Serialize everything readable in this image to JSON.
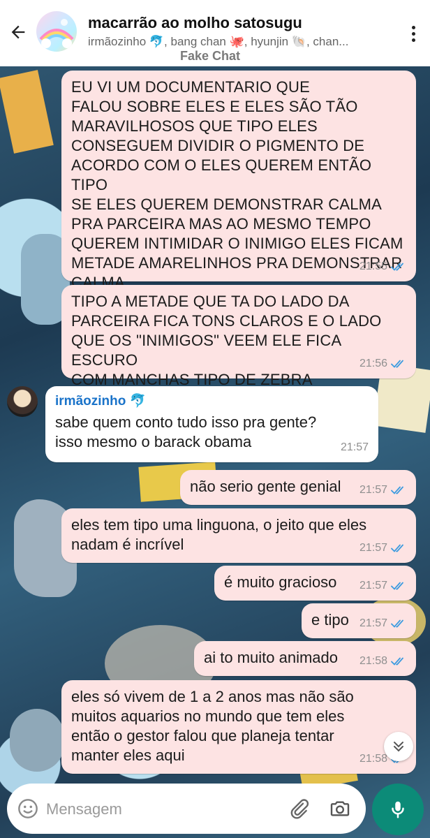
{
  "header": {
    "title": "macarrão ao molho satosugu",
    "subtitle": "irmãozinho 🐬, bang chan 🐙, hyunjin 🐚, chan...",
    "watermark": "Fake Chat"
  },
  "messages": [
    {
      "direction": "out",
      "text": "EU VI UM DOCUMENTARIO QUE\nFALOU SOBRE ELES E ELES SÃO TÃO\nMARAVILHOSOS QUE TIPO ELES\nCONSEGUEM DIVIDIR O PIGMENTO DE\nACORDO COM O ELES QUEREM ENTÃO TIPO\nSE ELES QUEREM DEMONSTRAR CALMA\nPRA PARCEIRA MAS AO MESMO TEMPO\nQUEREM INTIMIDAR O INIMIGO ELES FICAM\nMETADE AMARELINHOS PRA DEMONSTRAR\nCALMA",
      "time": "21:55"
    },
    {
      "direction": "out",
      "text": "TIPO A METADE QUE TA DO LADO DA\nPARCEIRA FICA TONS CLAROS E O LADO\nQUE OS \"INIMIGOS\" VEEM ELE FICA ESCURO\nCOM MANCHAS TIPO DE ZEBRA",
      "time": "21:56"
    },
    {
      "direction": "in",
      "sender": "irmãozinho 🐬",
      "text": "sabe quem conto tudo isso pra gente?\nisso mesmo o barack obama",
      "time": "21:57"
    },
    {
      "direction": "out",
      "text": "não serio gente genial",
      "time": "21:57"
    },
    {
      "direction": "out",
      "text": "eles tem tipo uma linguona, o jeito que eles\nnadam é incrível",
      "time": "21:57"
    },
    {
      "direction": "out",
      "text": "é muito gracioso",
      "time": "21:57"
    },
    {
      "direction": "out",
      "text": "e tipo",
      "time": "21:57"
    },
    {
      "direction": "out",
      "text": "ai to muito animado",
      "time": "21:58"
    },
    {
      "direction": "out",
      "text": "eles só vivem de 1 a 2 anos mas não são\nmuitos aquarios no mundo que tem eles\nentão o gestor falou que planeja tentar\nmanter eles aqui",
      "time": "21:58"
    }
  ],
  "composer": {
    "placeholder": "Mensagem",
    "value": ""
  },
  "icons": {
    "back": "arrow-left-icon",
    "menu": "more-vertical-icon",
    "read_receipt": "double-check-icon",
    "scroll": "chevrons-down-icon",
    "emoji": "emoji-icon",
    "attach": "paperclip-icon",
    "camera": "camera-icon",
    "mic": "mic-icon"
  },
  "colors": {
    "outgoing_bubble": "#fde3e3",
    "incoming_bubble": "#ffffff",
    "sender_name": "#1a73c9",
    "read_tick": "#3b9be0",
    "mic_button": "#0c8b78"
  }
}
